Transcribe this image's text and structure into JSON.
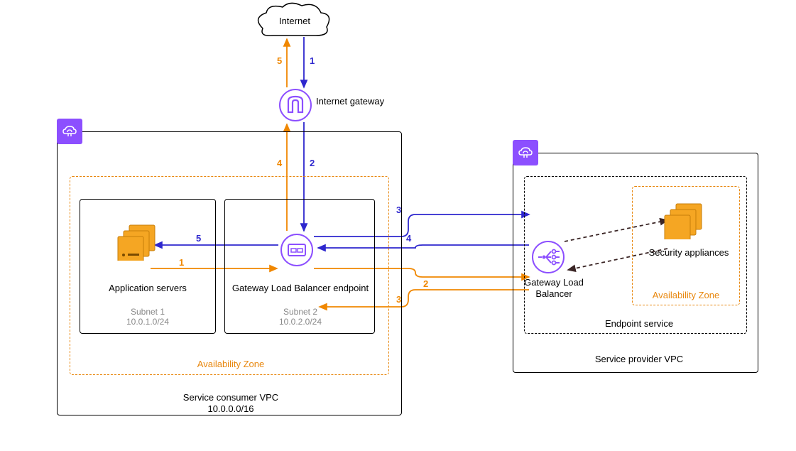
{
  "internet": {
    "label": "Internet"
  },
  "igw": {
    "label": "Internet gateway"
  },
  "consumer_vpc": {
    "title": "Service consumer VPC",
    "cidr": "10.0.0.0/16",
    "az_label": "Availability Zone",
    "subnet1": {
      "title": "Application servers",
      "name": "Subnet 1",
      "cidr": "10.0.1.0/24"
    },
    "subnet2": {
      "title": "Gateway Load Balancer endpoint",
      "name": "Subnet 2",
      "cidr": "10.0.2.0/24"
    }
  },
  "provider_vpc": {
    "title": "Service provider VPC",
    "endpoint_service_label": "Endpoint service",
    "az_label": "Availability Zone",
    "glb_label": "Gateway Load Balancer",
    "appliances_label": "Security appliances"
  },
  "flows": {
    "blue": {
      "n1": "1",
      "n2": "2",
      "n3": "3",
      "n4": "4",
      "n5": "5"
    },
    "orange": {
      "n1": "1",
      "n2": "2",
      "n3": "3",
      "n4": "4",
      "n5": "5"
    }
  }
}
